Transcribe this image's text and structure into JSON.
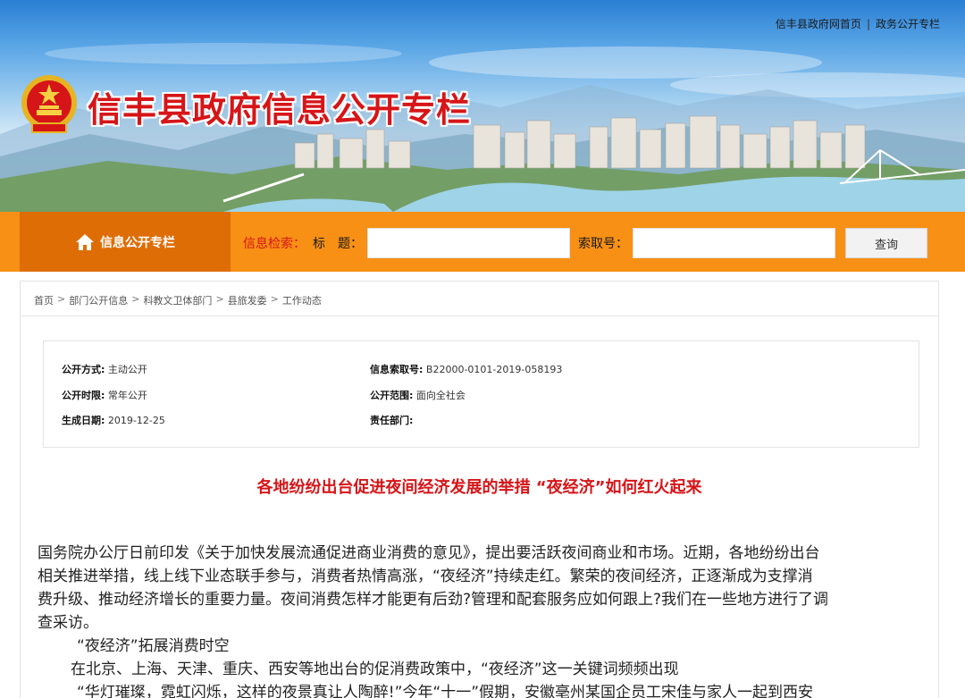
{
  "header": {
    "top_links": [
      "信丰县政府网首页",
      "政务公开专栏"
    ],
    "top_link_separator": "|",
    "site_title": "信丰县政府信息公开专栏"
  },
  "nav": {
    "home_label": "信息公开专栏",
    "search_label": "信息检索：",
    "title_label": "标　题：",
    "title_value": "",
    "code_label": "索取号：",
    "code_value": "",
    "search_button": "查询"
  },
  "breadcrumb": [
    "首页",
    "部门公开信息",
    "科教文卫体部门",
    "县旅发委",
    "工作动态"
  ],
  "breadcrumb_separator": ">",
  "meta": {
    "disclosure_method_label": "公开方式:",
    "disclosure_method": "主动公开",
    "index_no_label": "信息索取号:",
    "index_no": "B22000-0101-2019-058193",
    "disclosure_period_label": "公开时限:",
    "disclosure_period": "常年公开",
    "disclosure_scope_label": "公开范围:",
    "disclosure_scope": "面向全社会",
    "date_label": "生成日期:",
    "date": "2019-12-25",
    "dept_label": "责任部门:",
    "dept": ""
  },
  "article": {
    "title": "各地纷纷出台促进夜间经济发展的举措 “夜经济”如何红火起来",
    "paragraph1_lines": [
      "国务院办公厅日前印发《关于加快发展流通促进商业消费的意见》，提出要活跃夜间商业和市场。近期，各地纷纷出台",
      "相关推进举措，线上线下业态联手参与，消费者热情高涨，“夜经济”持续走红。繁荣的夜间经济，正逐渐成为支撑消",
      "费升级、推动经济增长的重要力量。夜间消费怎样才能更有后劲?管理和配套服务应如何跟上?我们在一些地方进行了调",
      "查采访。"
    ],
    "subheading": "“夜经济”拓展消费时空",
    "paragraph2": "在北京、上海、天津、重庆、西安等地出台的促消费政策中，“夜经济”这一关键词频频出现",
    "paragraph3": "“华灯璀璨，霓虹闪烁，这样的夜景真让人陶醉!”今年“十一”假期，安徽亳州某国企员工宋佳与家人一起到西安"
  },
  "colors": {
    "accent_red": "#d61518",
    "nav_orange": "#f79015",
    "nav_home_orange": "#de6d05"
  }
}
